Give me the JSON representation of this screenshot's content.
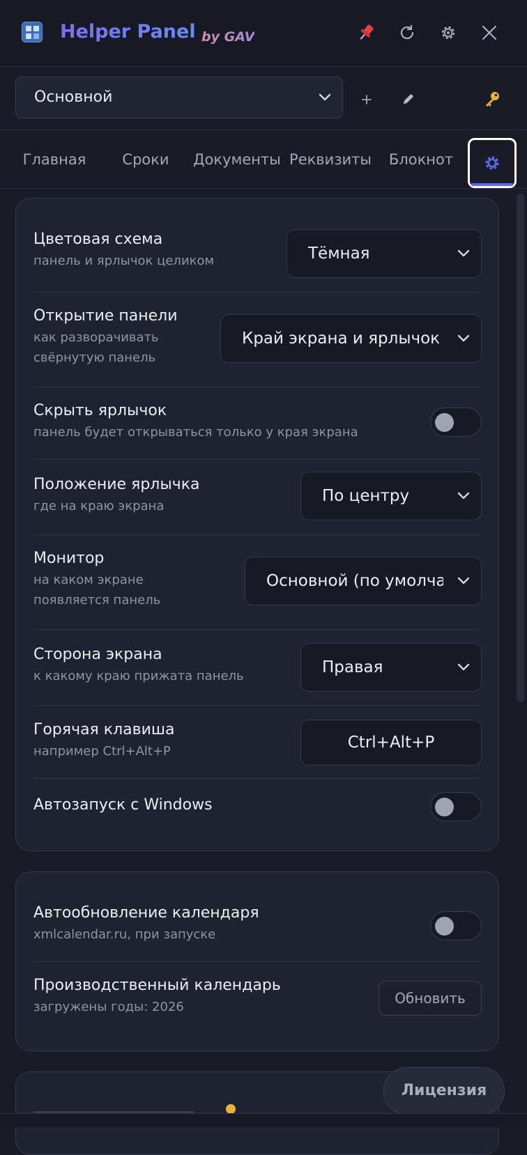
{
  "header": {
    "title": "Helper Panel",
    "by": "by GAV",
    "icons": [
      "pin-icon",
      "refresh-icon",
      "gear-icon",
      "close-icon"
    ]
  },
  "profile": {
    "selected": "Основной",
    "icons": [
      "plus-icon",
      "pencil-icon",
      "key-icon"
    ]
  },
  "tabs": [
    {
      "label": "Главная"
    },
    {
      "label": "Сроки"
    },
    {
      "label": "Документы"
    },
    {
      "label": "Реквизиты"
    },
    {
      "label": "Блокнот"
    }
  ],
  "settings_tab_icon": "gear-icon",
  "card1": {
    "color_scheme": {
      "title": "Цветовая схема",
      "desc": "панель и ярлычок целиком",
      "value": "Тёмная"
    },
    "panel_open": {
      "title": "Открытие панели",
      "desc1": "как разворачивать",
      "desc2": "свёрнутую панель",
      "value": "Край экрана и ярлычок"
    },
    "hide_tab": {
      "title": "Скрыть ярлычок",
      "desc": "панель будет открываться только у края экрана",
      "enabled": false
    },
    "tab_position": {
      "title": "Положение ярлычка",
      "desc": "где на краю экрана",
      "value": "По центру"
    },
    "monitor": {
      "title": "Монитор",
      "desc1": "на каком экране",
      "desc2": "появляется панель",
      "value": "Основной (по умолча"
    },
    "screen_side": {
      "title": "Сторона экрана",
      "desc": "к какому краю прижата панель",
      "value": "Правая"
    },
    "hotkey": {
      "title": "Горячая клавиша",
      "desc": "например Ctrl+Alt+P",
      "value": "Ctrl+Alt+P"
    },
    "autostart": {
      "title": "Автозапуск с Windows",
      "enabled": false
    }
  },
  "card2": {
    "calendar_autoupdate": {
      "title": "Автообновление календаря",
      "desc": "xmlcalendar.ru, при запуске",
      "enabled": false
    },
    "prod_calendar": {
      "title": "Производственный календарь",
      "desc": "загружены годы: 2026",
      "button": "Обновить"
    }
  },
  "license_button": "Лицензия",
  "colors": {
    "accent": "#5a6af0",
    "bg": "#191c26",
    "card": "#1f2230"
  }
}
